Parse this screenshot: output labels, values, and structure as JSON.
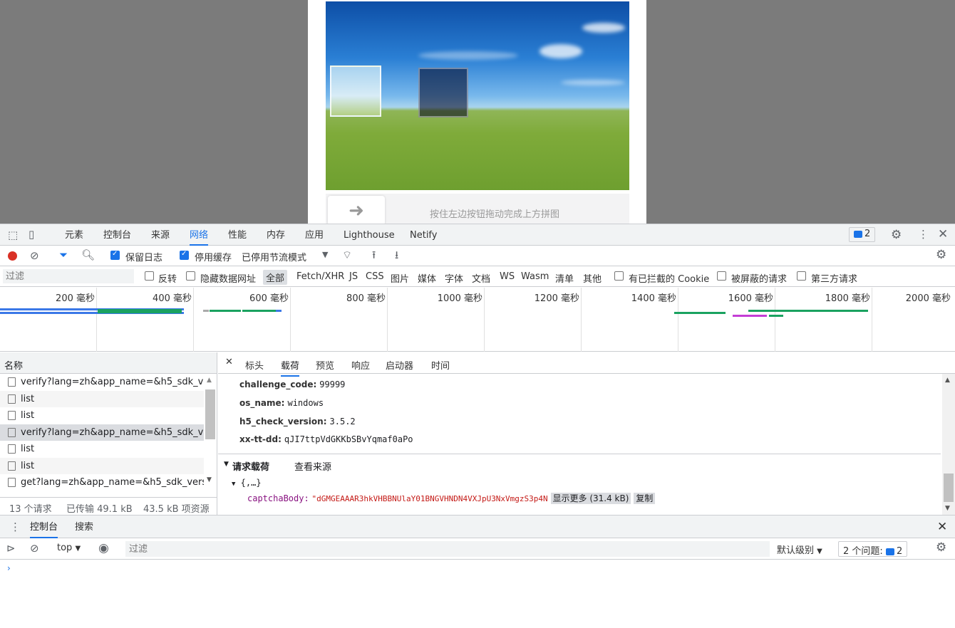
{
  "captcha": {
    "hint": "按住左边按钮拖动完成上方拼图"
  },
  "devtools": {
    "tabs": [
      "元素",
      "控制台",
      "来源",
      "网络",
      "性能",
      "内存",
      "应用",
      "Lighthouse",
      "Netify"
    ],
    "active_tab": "网络",
    "issues_count": "2",
    "network_toolbar": {
      "preserve_log": "保留日志",
      "disable_cache": "停用缓存",
      "throttling": "已停用节流模式"
    },
    "filter": {
      "placeholder": "过滤",
      "invert": "反转",
      "hide_data_urls": "隐藏数据网址",
      "types": [
        "全部",
        "Fetch/XHR",
        "JS",
        "CSS",
        "图片",
        "媒体",
        "字体",
        "文档",
        "WS",
        "Wasm",
        "清单",
        "其他"
      ],
      "blocked_cookies": "有已拦截的 Cookie",
      "blocked_requests": "被屏蔽的请求",
      "third_party": "第三方请求"
    },
    "timeline_ticks": [
      "200 毫秒",
      "400 毫秒",
      "600 毫秒",
      "800 毫秒",
      "1000 毫秒",
      "1200 毫秒",
      "1400 毫秒",
      "1600 毫秒",
      "1800 毫秒",
      "2000 毫秒"
    ],
    "request_list": {
      "header": "名称",
      "items": [
        "verify?lang=zh&app_name=&h5_sdk_version",
        "list",
        "list",
        "verify?lang=zh&app_name=&h5_sdk_version",
        "list",
        "list",
        "get?lang=zh&app_name=&h5_sdk_version"
      ],
      "status": {
        "requests": "13 个请求",
        "transferred": "已传输 49.1 kB",
        "resources": "43.5 kB 项资源"
      }
    },
    "detail": {
      "tabs": [
        "标头",
        "载荷",
        "预览",
        "响应",
        "启动器",
        "时间"
      ],
      "active_tab": "载荷",
      "query_params": [
        {
          "key": "challenge_code:",
          "value": "99999"
        },
        {
          "key": "os_name:",
          "value": "windows"
        },
        {
          "key": "h5_check_version:",
          "value": "3.5.2"
        },
        {
          "key": "xx-tt-dd:",
          "value": "qJI7ttpVdGKKbSBvYqmaf0aPo"
        }
      ],
      "payload_title": "请求载荷",
      "view_source": "查看来源",
      "object_preview": "{,…}",
      "body_key": "captchaBody:",
      "body_value": "\"dGMGEAAAR3hkVHBBNUlaY01BNGVHNDN4VXJpU3NxVmgzS3p4N",
      "show_more": "显示更多 (31.4 kB)",
      "copy": "复制"
    },
    "drawer": {
      "tabs": [
        "控制台",
        "搜索"
      ],
      "context": "top",
      "filter_placeholder": "过滤",
      "level": "默认级别",
      "issues": "2 个问题:",
      "issues_count": "2"
    }
  }
}
